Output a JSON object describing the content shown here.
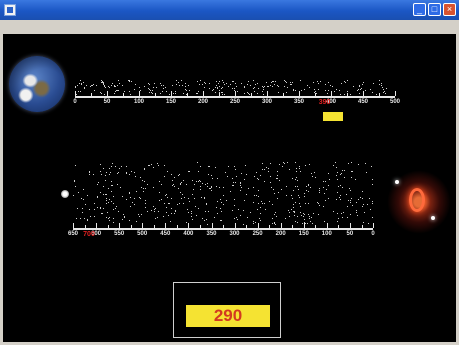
{
  "window": {
    "title": "",
    "menu": [
      "",
      ""
    ]
  },
  "captions": {
    "earth": [
      "",
      "",
      ""
    ],
    "distance_label": "",
    "distance_value": "",
    "distance_unit": "",
    "nebula": [
      "",
      "",
      "",
      ""
    ]
  },
  "upper_scale": {
    "labels": [
      "0",
      "50",
      "100",
      "150",
      "200",
      "250",
      "300",
      "350",
      "400",
      "450",
      "500"
    ],
    "marker": "390"
  },
  "lower_scale": {
    "labels": [
      "650",
      "600",
      "550",
      "500",
      "450",
      "400",
      "350",
      "300",
      "250",
      "200",
      "150",
      "100",
      "50",
      "0"
    ],
    "marker": "700"
  },
  "result": {
    "label": "",
    "value": "290"
  },
  "colors": {
    "background": "#000000",
    "caption": "#f5e332",
    "marker": "#e02020",
    "field": "#f5e332"
  },
  "icons": [
    "earth-icon",
    "photon-icon",
    "nebula-icon"
  ]
}
